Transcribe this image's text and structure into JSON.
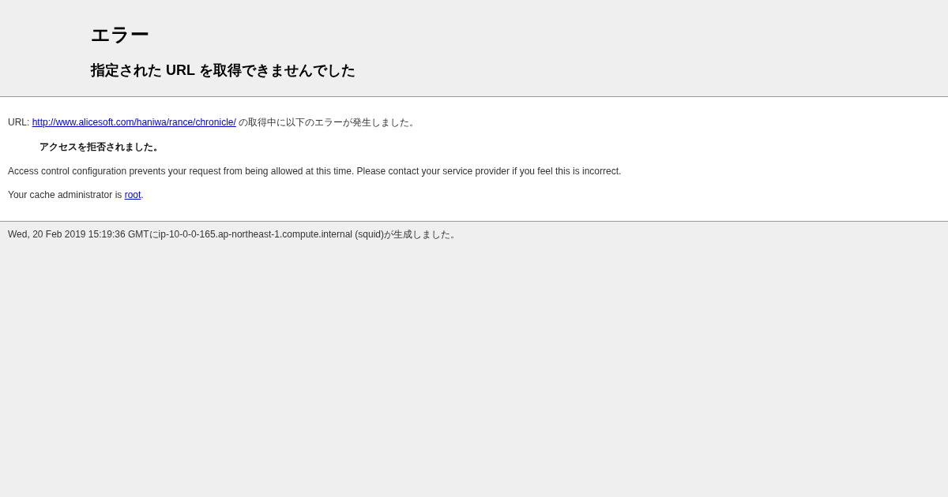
{
  "header": {
    "title": "エラー",
    "subtitle": "指定された URL を取得できませんでした"
  },
  "body": {
    "url_line": {
      "prefix": "URL: ",
      "link": "http://www.alicesoft.com/haniwa/rance/chronicle/",
      "suffix": " の取得中に以下のエラーが発生しました。"
    },
    "error": "アクセスを拒否されました。",
    "description": "Access control configuration prevents your request from being allowed at this time. Please contact your service provider if you feel this is incorrect.",
    "admin_line": {
      "prefix": "Your cache administrator is ",
      "link": "root",
      "suffix": "."
    }
  },
  "footer": "Wed, 20 Feb 2019 15:19:36 GMTにip-10-0-0-165.ap-northeast-1.compute.internal (squid)が生成しました。"
}
